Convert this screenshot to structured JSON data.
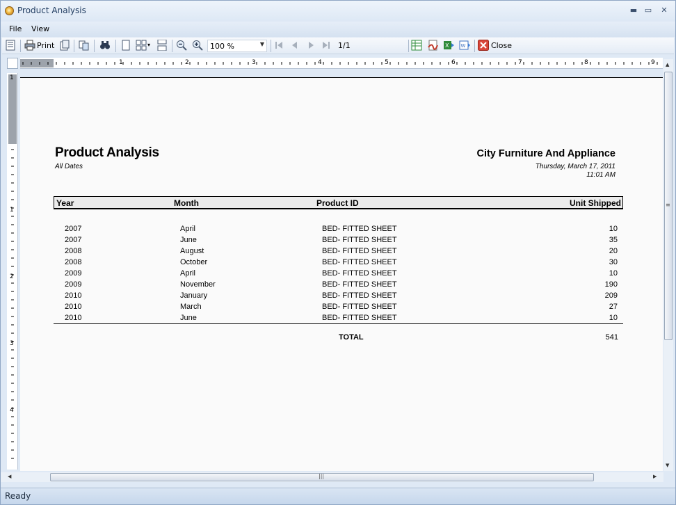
{
  "window": {
    "title": "Product Analysis",
    "controls": {
      "minimize": "▬",
      "maximize": "▭",
      "close": "✕"
    }
  },
  "menu": {
    "items": [
      "File",
      "View"
    ]
  },
  "toolbar": {
    "print_label": "Print",
    "zoom_value": "100 %",
    "page_indicator": "1/1",
    "close_label": "Close",
    "icons": [
      "toc-icon",
      "print-icon",
      "page-setup-icon",
      "copy-icon",
      "find-icon",
      "single-page-icon",
      "multi-page-icon",
      "continuous-icon",
      "zoom-out-icon",
      "zoom-in-icon",
      "first-page-icon",
      "prev-page-icon",
      "next-page-icon",
      "last-page-icon",
      "export-excel-icon",
      "export-pdf-icon",
      "export-xls-icon",
      "export-word-icon",
      "close-icon"
    ]
  },
  "ruler": {
    "h_numbers": [
      "1",
      "2",
      "3",
      "4",
      "5",
      "6",
      "7",
      "8",
      "9"
    ],
    "v_numbers": [
      "1",
      "1",
      "2",
      "3",
      "4"
    ]
  },
  "report": {
    "title": "Product Analysis",
    "subtitle": "All Dates",
    "company": "City Furniture And Appliance",
    "date": "Thursday, March 17, 2011",
    "time": "11:01 AM",
    "columns": [
      "Year",
      "Month",
      "Product ID",
      "Unit Shipped"
    ],
    "rows": [
      {
        "year": "2007",
        "month": "April",
        "product": "BED- FITTED SHEET",
        "units": "10"
      },
      {
        "year": "2007",
        "month": "June",
        "product": "BED- FITTED SHEET",
        "units": "35"
      },
      {
        "year": "2008",
        "month": "August",
        "product": "BED- FITTED SHEET",
        "units": "20"
      },
      {
        "year": "2008",
        "month": "October",
        "product": "BED- FITTED SHEET",
        "units": "30"
      },
      {
        "year": "2009",
        "month": "April",
        "product": "BED- FITTED SHEET",
        "units": "10"
      },
      {
        "year": "2009",
        "month": "November",
        "product": "BED- FITTED SHEET",
        "units": "190"
      },
      {
        "year": "2010",
        "month": "January",
        "product": "BED- FITTED SHEET",
        "units": "209"
      },
      {
        "year": "2010",
        "month": "March",
        "product": "BED- FITTED SHEET",
        "units": "27"
      },
      {
        "year": "2010",
        "month": "June",
        "product": "BED- FITTED SHEET",
        "units": "10"
      }
    ],
    "total_label": "TOTAL",
    "total_value": "541"
  },
  "status": {
    "text": "Ready"
  },
  "colors": {
    "chrome": "#dfe9f5",
    "page": "#fafafa",
    "header_fill": "#ebebeb",
    "export_red": "#c0392b",
    "export_green": "#2e8b3a"
  }
}
